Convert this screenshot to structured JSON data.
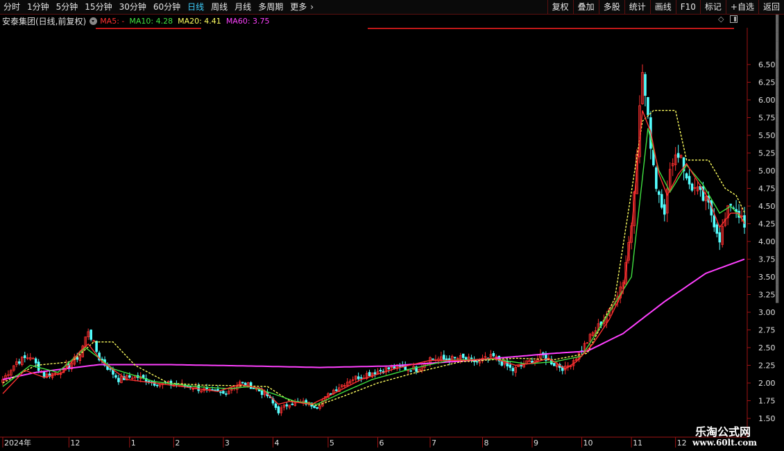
{
  "toolbar": {
    "periods": [
      "分时",
      "1分钟",
      "5分钟",
      "15分钟",
      "30分钟",
      "60分钟",
      "日线",
      "周线",
      "月线",
      "多周期",
      "更多"
    ],
    "active_period": "日线",
    "more_arrow": "chevron-right-icon",
    "tools": [
      "复权",
      "叠加",
      "多股",
      "统计",
      "画线",
      "F10",
      "标记",
      "+自选",
      "返回"
    ]
  },
  "info": {
    "title": "安泰集团(日线,前复权)",
    "ma5": "MA5: -",
    "ma10": "MA10: 4.28",
    "ma20": "MA20: 4.41",
    "ma60": "MA60: 3.75"
  },
  "colors": {
    "up": "#ff3030",
    "down": "#54ffff",
    "ma5": "#ff3030",
    "ma10": "#40e040",
    "ma20": "#ffff60",
    "ma60": "#ff40ff",
    "axis": "#a01414",
    "text": "#e0e0e0"
  },
  "watermark": {
    "line1": "乐淘公式网",
    "line2": "www.60lt.com"
  },
  "chart_data": {
    "type": "candlestick",
    "ylim": [
      1.5,
      7.0
    ],
    "y_ticks": [
      1.5,
      1.75,
      2.0,
      2.25,
      2.5,
      2.75,
      3.0,
      3.25,
      3.5,
      3.75,
      4.0,
      4.25,
      4.5,
      4.75,
      5.0,
      5.25,
      5.5,
      5.75,
      6.0,
      6.25,
      6.5
    ],
    "y_tick_labels": [
      "1.50",
      "1.75",
      "2.00",
      "2.25",
      "2.50",
      "2.75",
      "3.00",
      "3.25",
      "3.50",
      "3.75",
      "4.00",
      "4.25",
      "4.50",
      "4.75",
      "5.00",
      "5.25",
      "5.50",
      "5.75",
      "6.00",
      "6.25",
      "6.50"
    ],
    "x_labels": [
      "2024年",
      "12",
      "1",
      "2",
      "3",
      "4",
      "5",
      "6",
      "7",
      "8",
      "9",
      "10",
      "11",
      "12"
    ],
    "x_label_index": [
      0,
      24,
      46,
      62,
      80,
      98,
      118,
      136,
      155,
      174,
      192,
      210,
      228,
      244
    ],
    "n_bars": 270,
    "close_anchors": [
      [
        0,
        2.05
      ],
      [
        5,
        2.3
      ],
      [
        10,
        2.38
      ],
      [
        15,
        2.1
      ],
      [
        22,
        2.18
      ],
      [
        28,
        2.4
      ],
      [
        31,
        2.75
      ],
      [
        35,
        2.35
      ],
      [
        42,
        2.05
      ],
      [
        48,
        2.1
      ],
      [
        55,
        2.0
      ],
      [
        62,
        1.98
      ],
      [
        68,
        1.95
      ],
      [
        75,
        1.88
      ],
      [
        80,
        1.85
      ],
      [
        86,
        2.0
      ],
      [
        90,
        1.96
      ],
      [
        96,
        1.82
      ],
      [
        100,
        1.6
      ],
      [
        104,
        1.72
      ],
      [
        110,
        1.72
      ],
      [
        114,
        1.67
      ],
      [
        120,
        1.9
      ],
      [
        126,
        2.05
      ],
      [
        134,
        2.15
      ],
      [
        142,
        2.22
      ],
      [
        150,
        2.2
      ],
      [
        155,
        2.35
      ],
      [
        160,
        2.33
      ],
      [
        166,
        2.35
      ],
      [
        172,
        2.3
      ],
      [
        178,
        2.37
      ],
      [
        185,
        2.18
      ],
      [
        190,
        2.28
      ],
      [
        196,
        2.38
      ],
      [
        200,
        2.27
      ],
      [
        204,
        2.2
      ],
      [
        208,
        2.37
      ],
      [
        214,
        2.7
      ],
      [
        220,
        3.0
      ],
      [
        225,
        3.45
      ],
      [
        228,
        4.25
      ],
      [
        232,
        6.4
      ],
      [
        234,
        5.7
      ],
      [
        237,
        4.8
      ],
      [
        240,
        4.45
      ],
      [
        243,
        5.2
      ],
      [
        246,
        5.25
      ],
      [
        248,
        4.85
      ],
      [
        252,
        4.7
      ],
      [
        256,
        4.5
      ],
      [
        260,
        4.05
      ],
      [
        264,
        4.55
      ],
      [
        267,
        4.4
      ],
      [
        269,
        4.18
      ]
    ],
    "ma5_anchors": [
      [
        0,
        1.85
      ],
      [
        8,
        2.18
      ],
      [
        15,
        2.08
      ],
      [
        22,
        2.15
      ],
      [
        28,
        2.45
      ],
      [
        31,
        2.55
      ],
      [
        36,
        2.3
      ],
      [
        45,
        2.05
      ],
      [
        55,
        2.0
      ],
      [
        65,
        1.95
      ],
      [
        78,
        1.88
      ],
      [
        86,
        1.98
      ],
      [
        94,
        1.92
      ],
      [
        100,
        1.7
      ],
      [
        104,
        1.74
      ],
      [
        112,
        1.7
      ],
      [
        120,
        1.85
      ],
      [
        130,
        2.05
      ],
      [
        142,
        2.2
      ],
      [
        155,
        2.32
      ],
      [
        168,
        2.32
      ],
      [
        178,
        2.35
      ],
      [
        186,
        2.25
      ],
      [
        192,
        2.28
      ],
      [
        198,
        2.35
      ],
      [
        204,
        2.2
      ],
      [
        208,
        2.3
      ],
      [
        214,
        2.55
      ],
      [
        220,
        2.9
      ],
      [
        225,
        3.3
      ],
      [
        228,
        4.15
      ],
      [
        232,
        5.85
      ],
      [
        235,
        5.55
      ],
      [
        238,
        4.95
      ],
      [
        241,
        4.65
      ],
      [
        245,
        4.95
      ],
      [
        248,
        5.1
      ],
      [
        252,
        4.85
      ],
      [
        256,
        4.6
      ],
      [
        260,
        4.2
      ],
      [
        264,
        4.4
      ],
      [
        267,
        4.4
      ],
      [
        269,
        4.25
      ]
    ],
    "ma10_anchors": [
      [
        0,
        1.95
      ],
      [
        10,
        2.25
      ],
      [
        20,
        2.15
      ],
      [
        30,
        2.5
      ],
      [
        40,
        2.2
      ],
      [
        55,
        2.02
      ],
      [
        70,
        1.95
      ],
      [
        82,
        1.92
      ],
      [
        90,
        1.95
      ],
      [
        98,
        1.85
      ],
      [
        106,
        1.74
      ],
      [
        114,
        1.7
      ],
      [
        124,
        1.88
      ],
      [
        134,
        2.05
      ],
      [
        148,
        2.2
      ],
      [
        162,
        2.32
      ],
      [
        178,
        2.34
      ],
      [
        190,
        2.27
      ],
      [
        200,
        2.3
      ],
      [
        210,
        2.38
      ],
      [
        228,
        3.5
      ],
      [
        234,
        5.6
      ],
      [
        238,
        5.0
      ],
      [
        242,
        4.7
      ],
      [
        248,
        5.08
      ],
      [
        254,
        4.8
      ],
      [
        260,
        4.4
      ],
      [
        264,
        4.5
      ],
      [
        269,
        4.28
      ]
    ],
    "ma20_anchors": [
      [
        0,
        2.0
      ],
      [
        12,
        2.25
      ],
      [
        25,
        2.3
      ],
      [
        33,
        2.58
      ],
      [
        40,
        2.58
      ],
      [
        48,
        2.25
      ],
      [
        60,
        2.0
      ],
      [
        72,
        1.97
      ],
      [
        88,
        1.96
      ],
      [
        96,
        1.95
      ],
      [
        104,
        1.75
      ],
      [
        114,
        1.68
      ],
      [
        124,
        1.82
      ],
      [
        136,
        2.0
      ],
      [
        150,
        2.15
      ],
      [
        166,
        2.3
      ],
      [
        186,
        2.35
      ],
      [
        200,
        2.33
      ],
      [
        212,
        2.42
      ],
      [
        222,
        3.2
      ],
      [
        232,
        5.7
      ],
      [
        236,
        5.85
      ],
      [
        244,
        5.85
      ],
      [
        248,
        5.15
      ],
      [
        256,
        5.15
      ],
      [
        262,
        4.75
      ],
      [
        266,
        4.65
      ],
      [
        269,
        4.41
      ]
    ],
    "ma60_anchors": [
      [
        0,
        2.05
      ],
      [
        12,
        2.15
      ],
      [
        35,
        2.26
      ],
      [
        60,
        2.26
      ],
      [
        90,
        2.24
      ],
      [
        115,
        2.22
      ],
      [
        140,
        2.24
      ],
      [
        170,
        2.32
      ],
      [
        200,
        2.42
      ],
      [
        212,
        2.45
      ],
      [
        225,
        2.7
      ],
      [
        240,
        3.15
      ],
      [
        255,
        3.55
      ],
      [
        269,
        3.75
      ]
    ],
    "line_styles": {
      "ma5": "solid",
      "ma10": "solid",
      "ma20": "dashed",
      "ma60": "solid"
    }
  }
}
